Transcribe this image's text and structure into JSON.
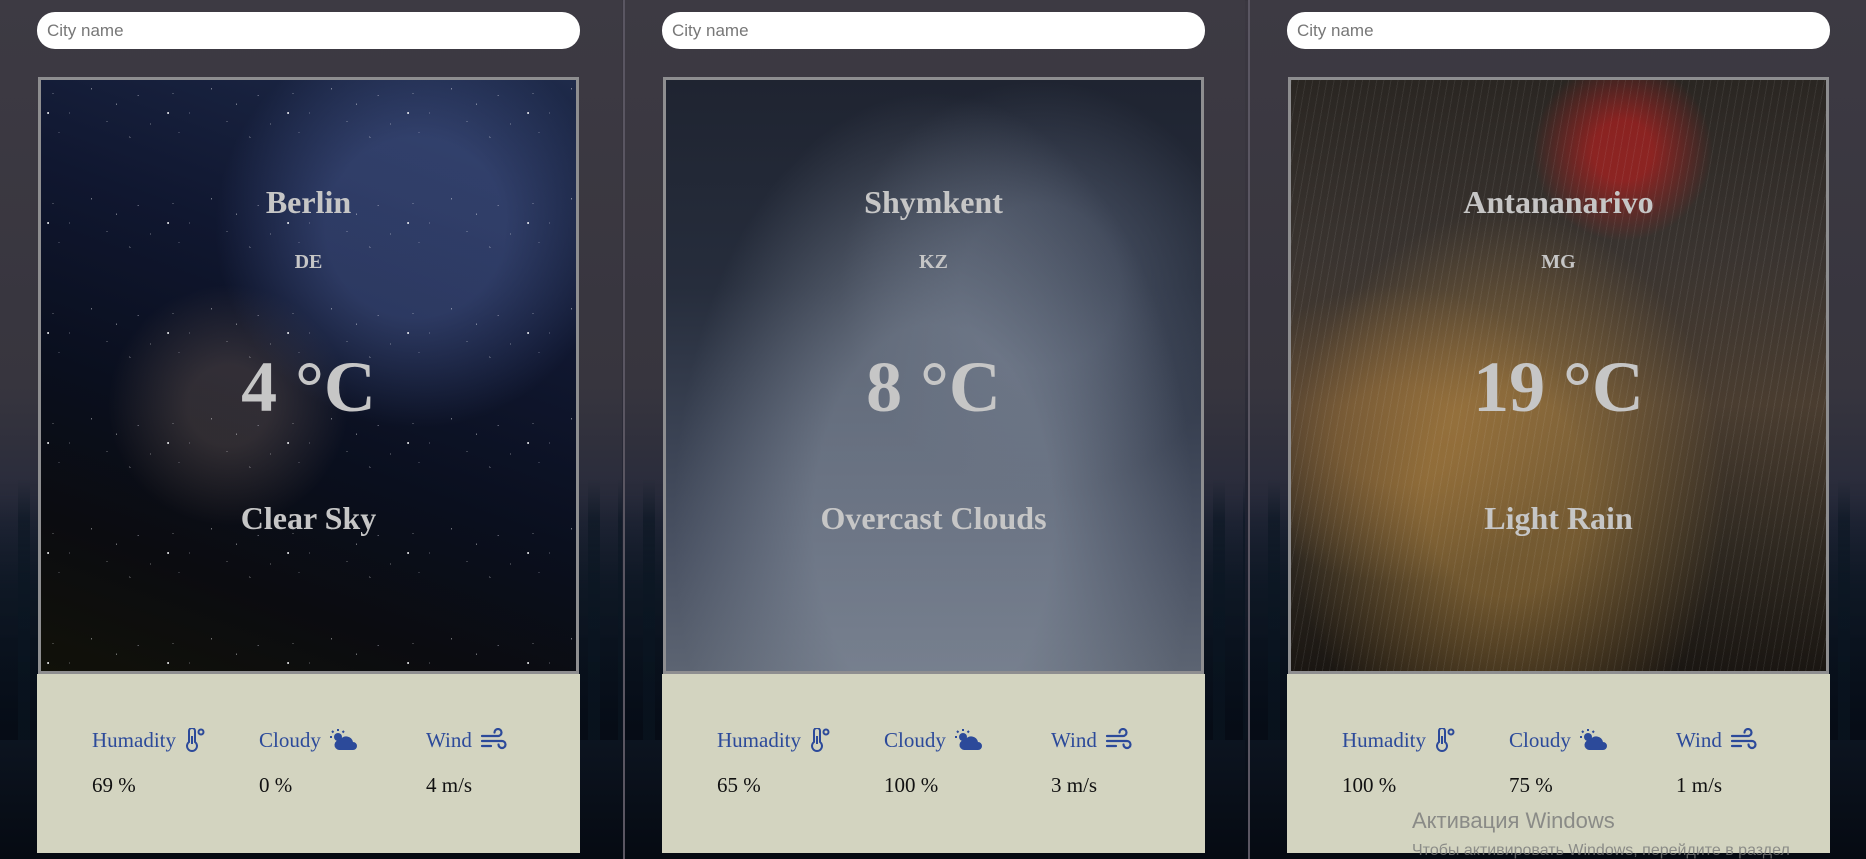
{
  "search": {
    "placeholder": "City name"
  },
  "cards": [
    {
      "city": "Berlin",
      "country": "DE",
      "temp": "4 °C",
      "description": "Clear Sky",
      "humidity_label": "Humadity",
      "humidity": "69 %",
      "cloudy_label": "Cloudy",
      "cloudy": "0 %",
      "wind_label": "Wind",
      "wind": "4 m/s"
    },
    {
      "city": "Shymkent",
      "country": "KZ",
      "temp": "8 °C",
      "description": "Overcast Clouds",
      "humidity_label": "Humadity",
      "humidity": "65 %",
      "cloudy_label": "Cloudy",
      "cloudy": "100 %",
      "wind_label": "Wind",
      "wind": "3 m/s"
    },
    {
      "city": "Antananarivo",
      "country": "MG",
      "temp": "19 °C",
      "description": "Light Rain",
      "humidity_label": "Humadity",
      "humidity": "100 %",
      "cloudy_label": "Cloudy",
      "cloudy": "75 %",
      "wind_label": "Wind",
      "wind": "1 m/s"
    }
  ],
  "icons": {
    "humidity": "thermometer-icon",
    "cloudy": "sun-cloud-icon",
    "wind": "wind-icon"
  },
  "colors": {
    "label_blue": "#2c4a9a",
    "details_bg": "#d3d4c0",
    "card_text": "#c6c6c6"
  },
  "watermark": {
    "title": "Активация Windows",
    "subtitle": "Чтобы активировать Windows, перейдите в раздел"
  }
}
